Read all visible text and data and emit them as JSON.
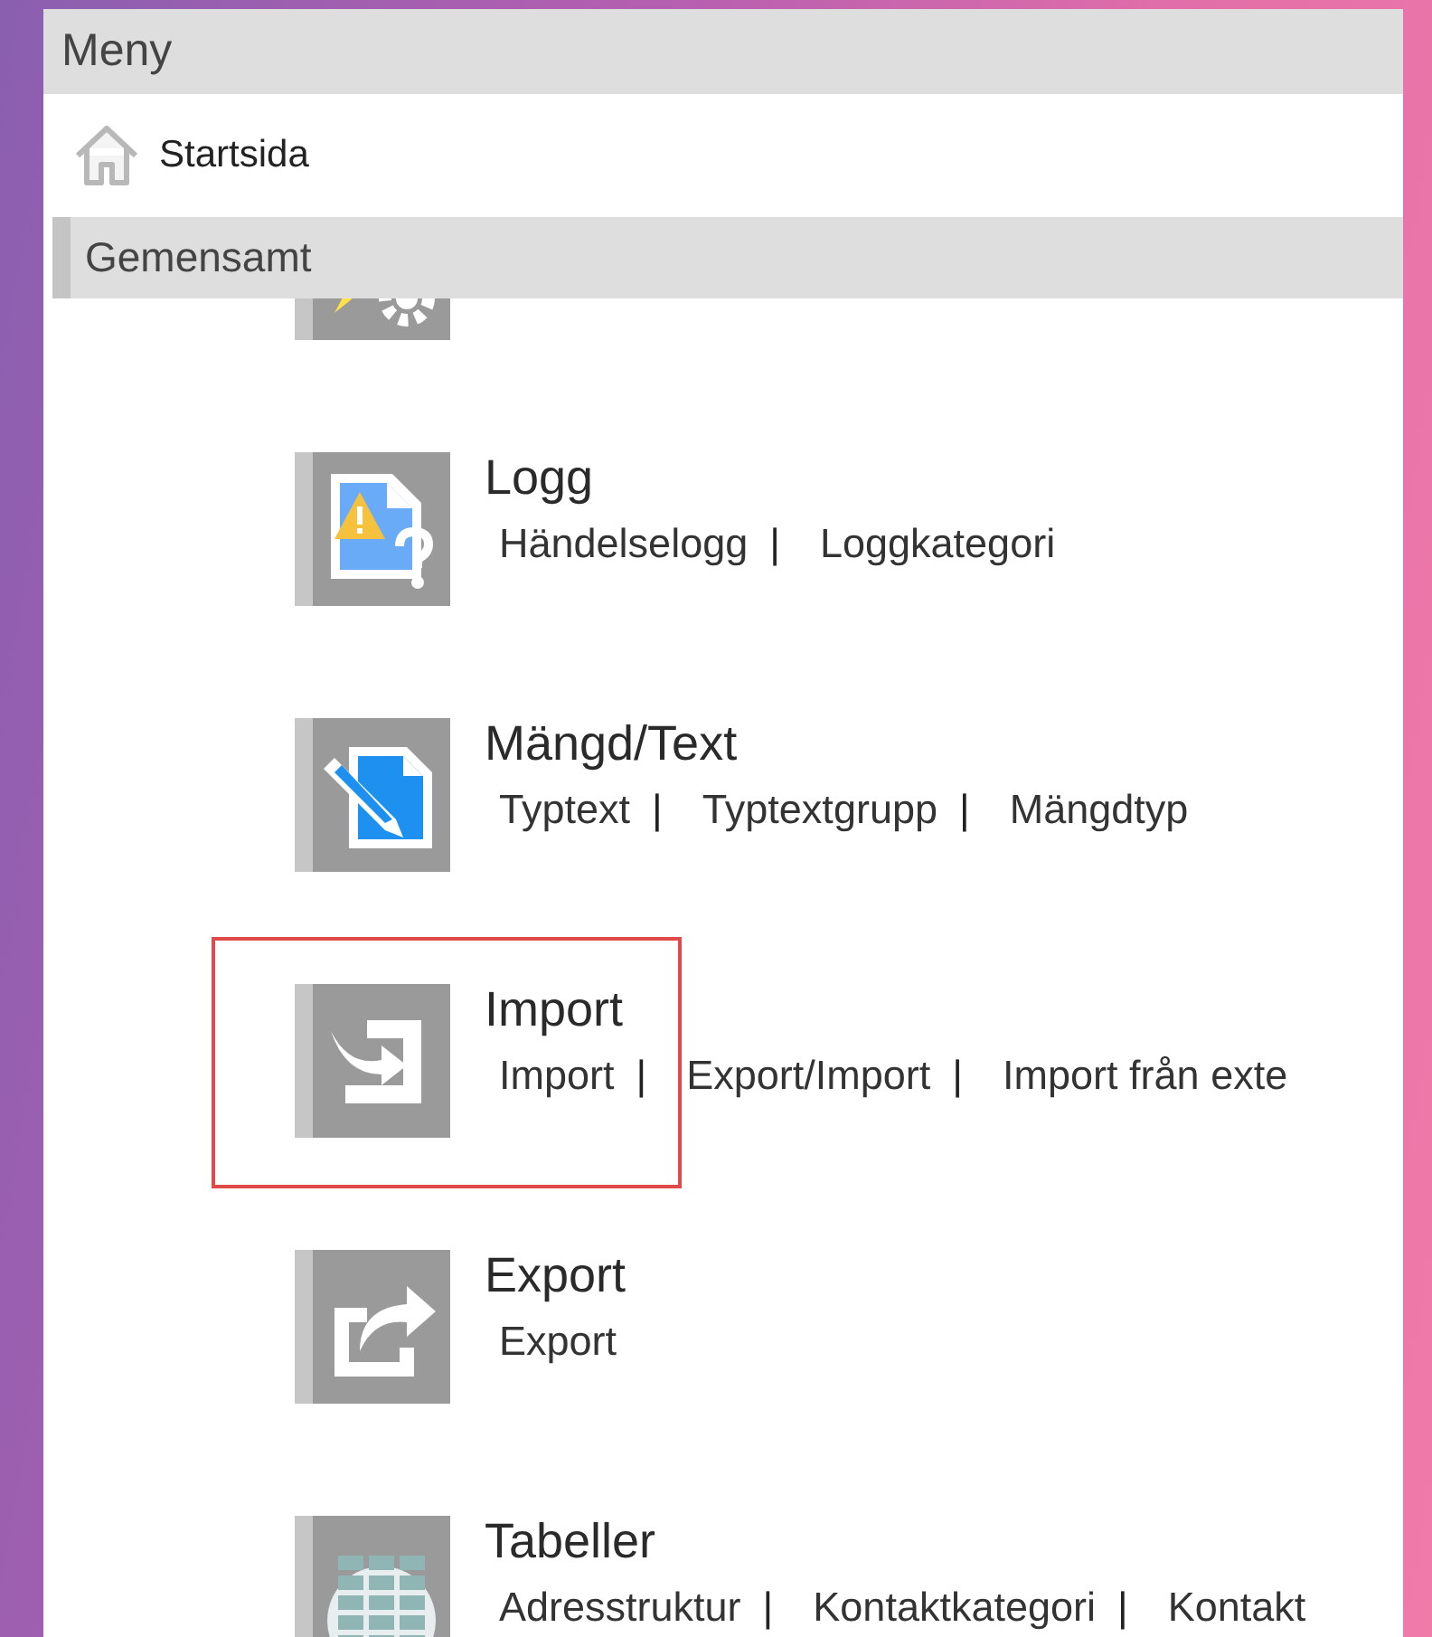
{
  "menu": {
    "title": "Meny",
    "home": {
      "label": "Startsida"
    },
    "section": {
      "label": "Gemensamt"
    },
    "items": [
      {
        "kind": "gear-lightning",
        "highlighted": false
      },
      {
        "kind": "warning-document",
        "title": "Logg",
        "highlighted": false,
        "links": [
          {
            "kind": "link",
            "text": "Händelselogg"
          },
          {
            "kind": "separator",
            "text": "|"
          },
          {
            "kind": "link",
            "text": "Loggkategori"
          }
        ]
      },
      {
        "kind": "edit-document",
        "title": "Mängd/Text",
        "highlighted": false,
        "links": [
          {
            "kind": "link",
            "text": "Typtext"
          },
          {
            "kind": "separator",
            "text": "|"
          },
          {
            "kind": "link",
            "text": "Typtextgrupp"
          },
          {
            "kind": "separator",
            "text": "|"
          },
          {
            "kind": "link",
            "text": "Mängdtyp"
          }
        ]
      },
      {
        "kind": "import",
        "title": "Import",
        "highlighted": true,
        "links": [
          {
            "kind": "link",
            "text": "Import"
          },
          {
            "kind": "separator",
            "text": "|"
          },
          {
            "kind": "link",
            "text": "Export/Import"
          },
          {
            "kind": "separator",
            "text": "|"
          },
          {
            "kind": "link",
            "text": "Import från exte"
          }
        ]
      },
      {
        "kind": "export",
        "title": "Export",
        "highlighted": false,
        "links": [
          {
            "kind": "link",
            "text": "Export"
          }
        ]
      },
      {
        "kind": "table",
        "title": "Tabeller",
        "highlighted": false,
        "links": [
          {
            "kind": "link",
            "text": "Adresstruktur"
          },
          {
            "kind": "separator",
            "text": "|"
          },
          {
            "kind": "link",
            "text": "Kontaktkategori"
          },
          {
            "kind": "separator",
            "text": "|"
          },
          {
            "kind": "link",
            "text": "Kontakt"
          }
        ]
      }
    ]
  }
}
